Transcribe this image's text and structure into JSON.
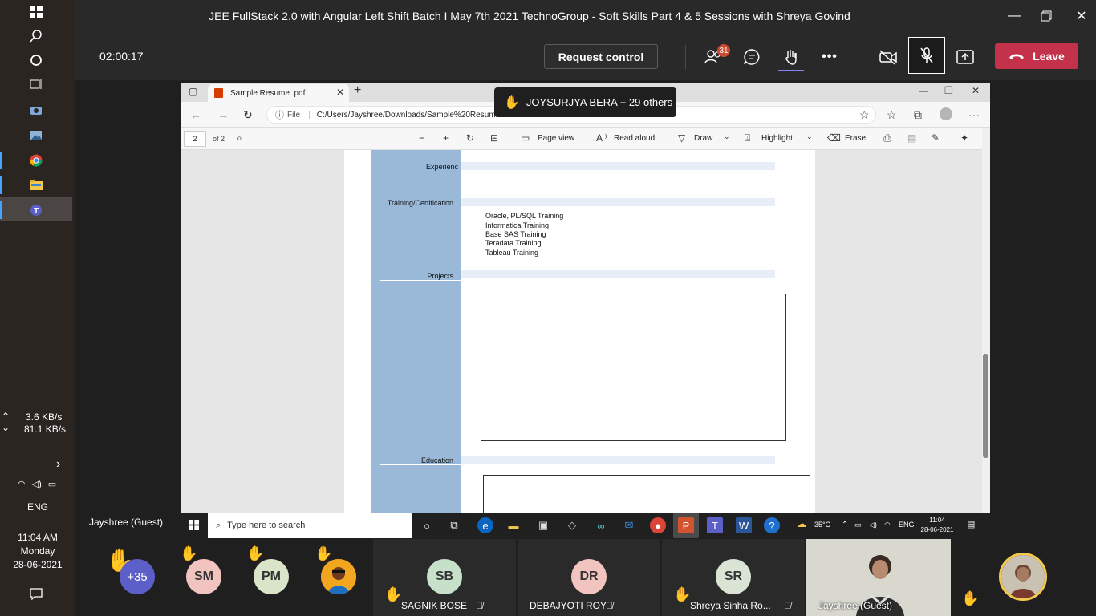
{
  "window": {
    "title": "JEE FullStack 2.0 with Angular Left Shift Batch I May 7th 2021 TechnoGroup - Soft Skills Part 4 & 5 Sessions with Shreya Govind"
  },
  "meeting_controls": {
    "timer": "02:00:17",
    "request_control": "Request control",
    "participants_count": "31",
    "leave": "Leave"
  },
  "raised_hand_toast": {
    "text": "JOYSURJYA BERA + 29 others"
  },
  "browser": {
    "tab_title": "Sample Resume .pdf",
    "address_label": "File",
    "url": "C:/Users/Jayshree/Downloads/Sample%20Resum"
  },
  "pdf_toolbar": {
    "page": "2",
    "page_of": "of 2",
    "page_view": "Page view",
    "read_aloud": "Read aloud",
    "draw": "Draw",
    "highlight": "Highlight",
    "erase": "Erase"
  },
  "resume": {
    "sections": {
      "experience": "Experienc",
      "training": "Training/Certification",
      "projects": "Projects",
      "education": "Education"
    },
    "trainings": [
      "Oracle, PL/SQL Training",
      "Informatica Training",
      "Base SAS Training",
      "Teradata Training",
      "Tableau Training"
    ]
  },
  "presenter": {
    "name": "Jayshree (Guest)"
  },
  "remote_taskbar": {
    "search_placeholder": "Type here to search",
    "weather": "35°C",
    "lang": "ENG",
    "time": "11:04",
    "date": "28-06-2021"
  },
  "local_taskbar": {
    "upload_speed": "3.6 KB/s",
    "download_speed": "81.1 KB/s",
    "lang": "ENG",
    "time": "11:04 AM",
    "day": "Monday",
    "date": "28-06-2021"
  },
  "participants": {
    "overflow": "+35",
    "tiles": [
      {
        "initials": "SM",
        "color": "#f2c4c0"
      },
      {
        "initials": "PM",
        "color": "#d9e4c8"
      },
      {
        "initials": "SB",
        "name": "SAGNIK BOSE",
        "color": "#c6e0c9"
      },
      {
        "initials": "DR",
        "name": "DEBAJYOTI ROY",
        "color": "#f2c4c0"
      },
      {
        "initials": "SR",
        "name": "Shreya Sinha Ro...",
        "color": "#d9e4d5"
      },
      {
        "name": "Jayshree (Guest)"
      }
    ]
  },
  "colors": {
    "leave": "#c4314b",
    "raise_underline": "#7f85f5",
    "badge": "#cc4a31",
    "resume_sidebar": "#9ab9d9"
  }
}
